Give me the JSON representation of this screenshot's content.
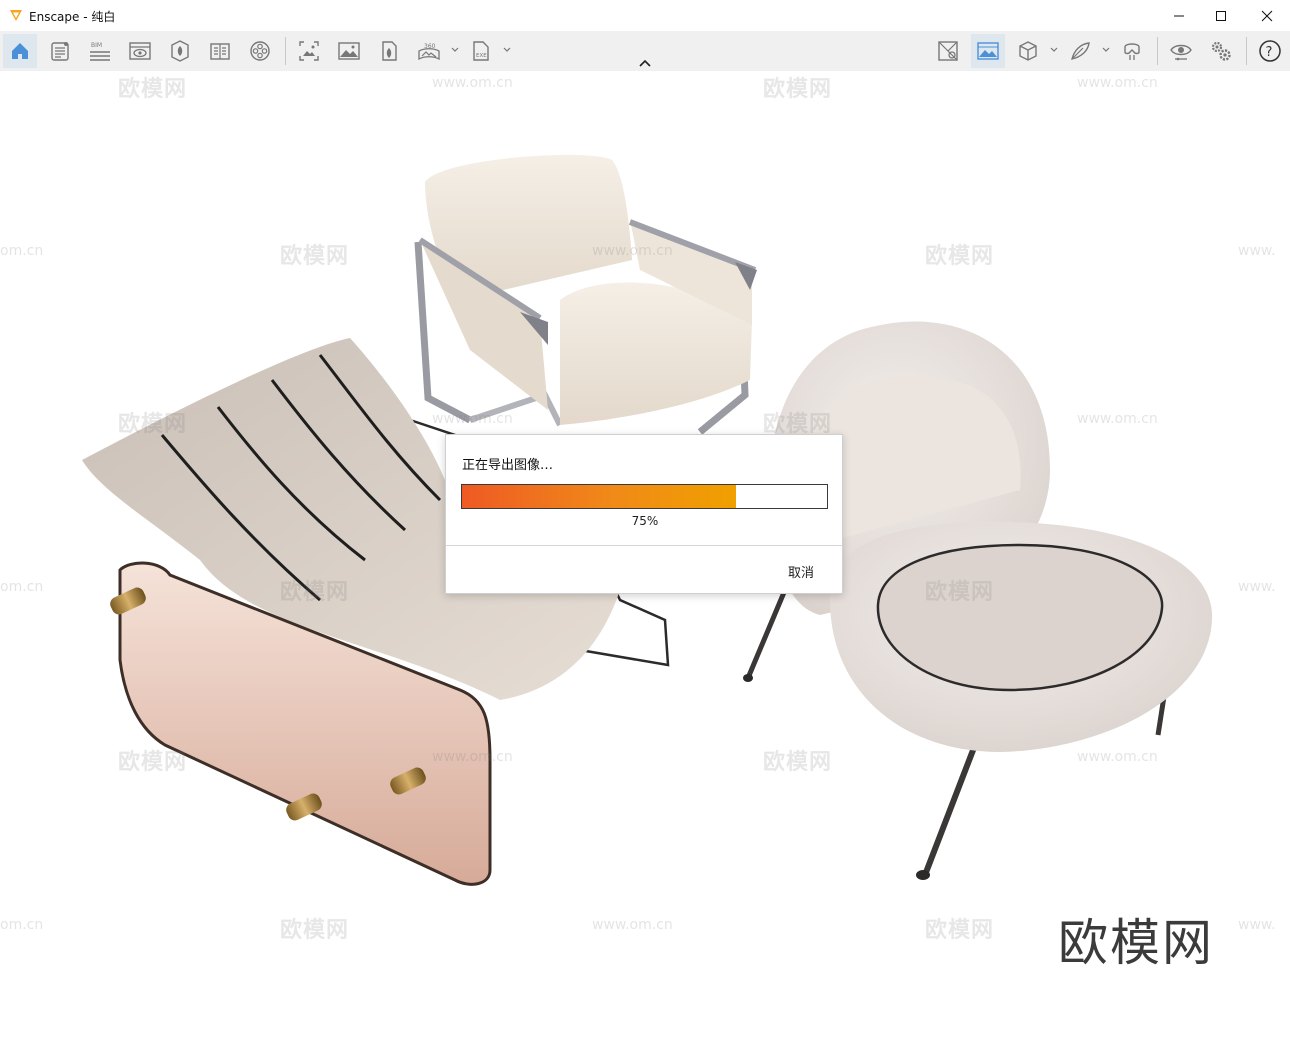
{
  "window": {
    "title": "Enscape - 纯白",
    "controls": [
      "minimize",
      "maximize",
      "close"
    ]
  },
  "toolbar": {
    "left_icons": [
      "home-icon",
      "document-list-icon",
      "bim-icon",
      "view-eye-icon",
      "asset-library-icon",
      "book-icon",
      "material-reel-icon"
    ],
    "bim_label": "BIM",
    "capture_icons": [
      "screenshot-icon",
      "image-icon",
      "panorama-icon",
      "panorama-360-icon",
      "export-exe-icon"
    ],
    "badge_360": "360",
    "badge_exe": "EXE",
    "right_icons": [
      "map-icon",
      "sky-image-icon",
      "cube-icon",
      "feather-icon",
      "vr-headset-icon",
      "visual-settings-eye-icon",
      "gears-icon",
      "help-icon"
    ],
    "help_symbol": "?"
  },
  "watermarks": {
    "brand_text": "欧模网",
    "url_text": "www.om.cn",
    "url_fragment": "om.cn",
    "url_fragment_right": "www.",
    "corner_brand": "欧模网"
  },
  "colors": {
    "accent": "#4a90d9",
    "progress_start": "#ee5a24",
    "progress_end": "#f0a000"
  },
  "dialog": {
    "message": "正在导出图像…",
    "progress": 0.75,
    "progress_label": "75%",
    "cancel_label": "取消"
  }
}
